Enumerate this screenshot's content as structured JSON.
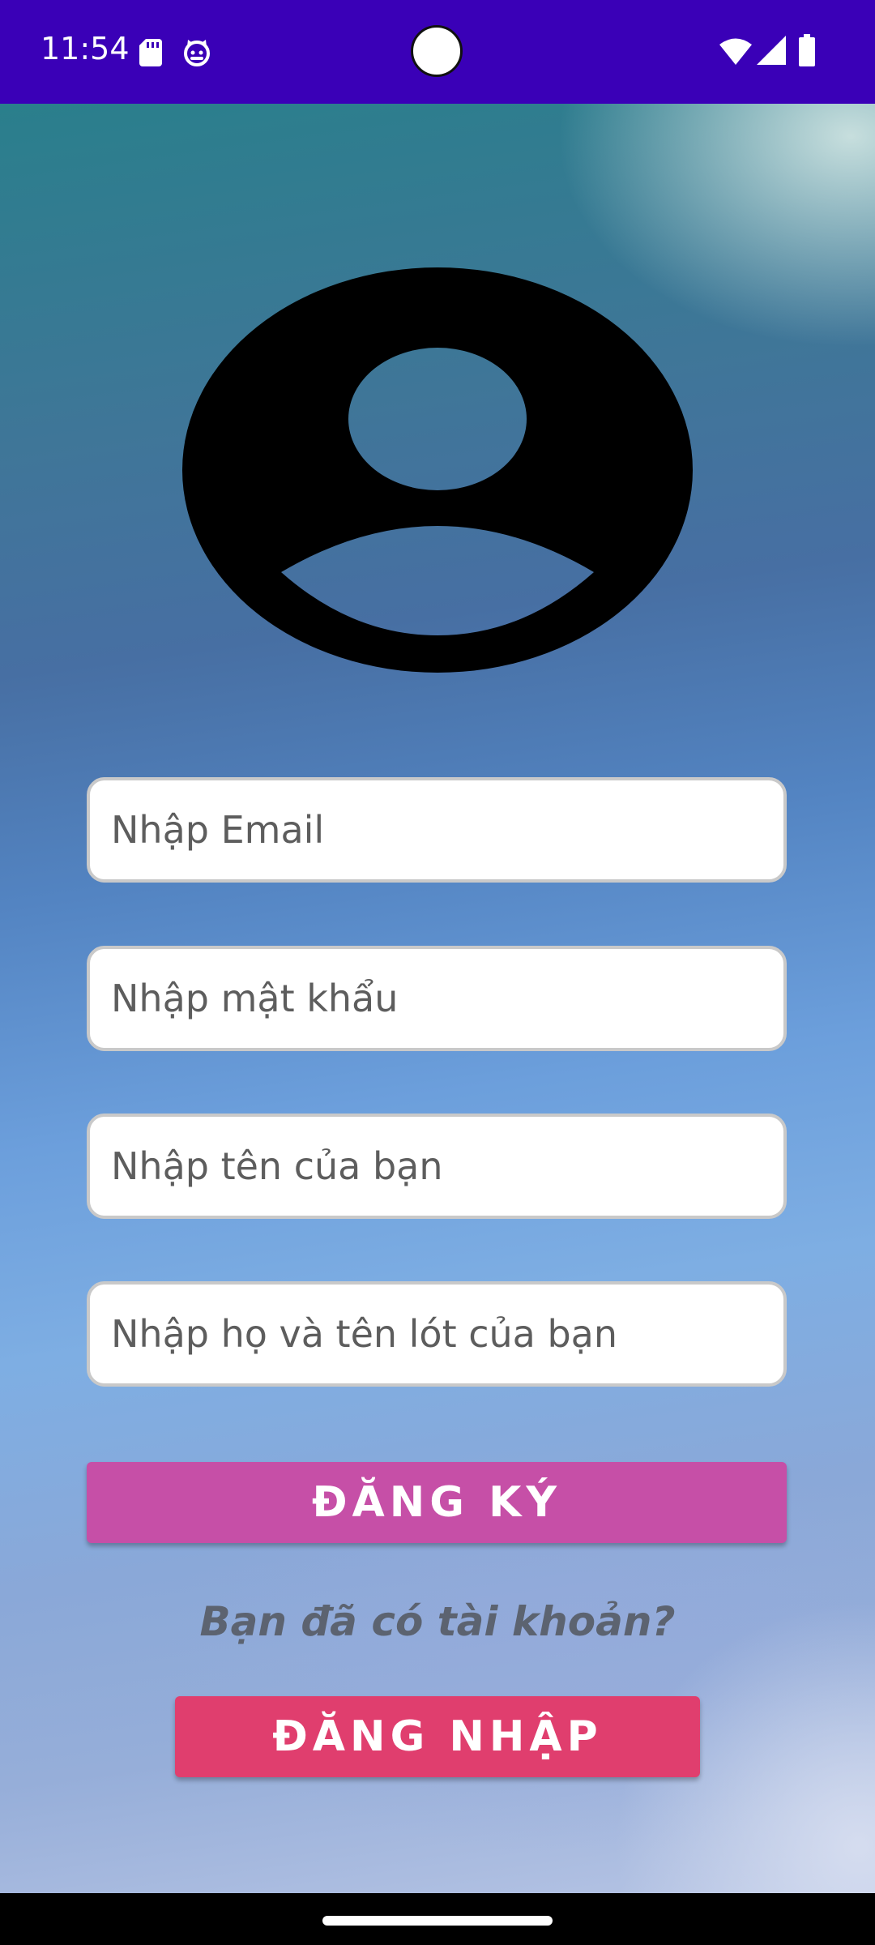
{
  "status_bar": {
    "time": "11:54",
    "background": "#3a00b7",
    "icons": [
      "sd-card-icon",
      "cat-face-icon",
      "wifi-icon",
      "signal-icon",
      "battery-icon"
    ]
  },
  "avatar": {
    "icon": "person-circle-icon",
    "color": "#000000"
  },
  "form": {
    "email_placeholder": "Nhập Email",
    "password_placeholder": "Nhập mật khẩu",
    "firstname_placeholder": "Nhập tên của bạn",
    "lastname_placeholder": "Nhập họ và tên lót của bạn"
  },
  "buttons": {
    "register_label": "ĐĂNG KÝ",
    "register_color": "#c64fa7",
    "login_label": "ĐĂNG NHẬP",
    "login_color": "#e03e6e"
  },
  "prompt": {
    "have_account": "Bạn đã có tài khoản?"
  }
}
